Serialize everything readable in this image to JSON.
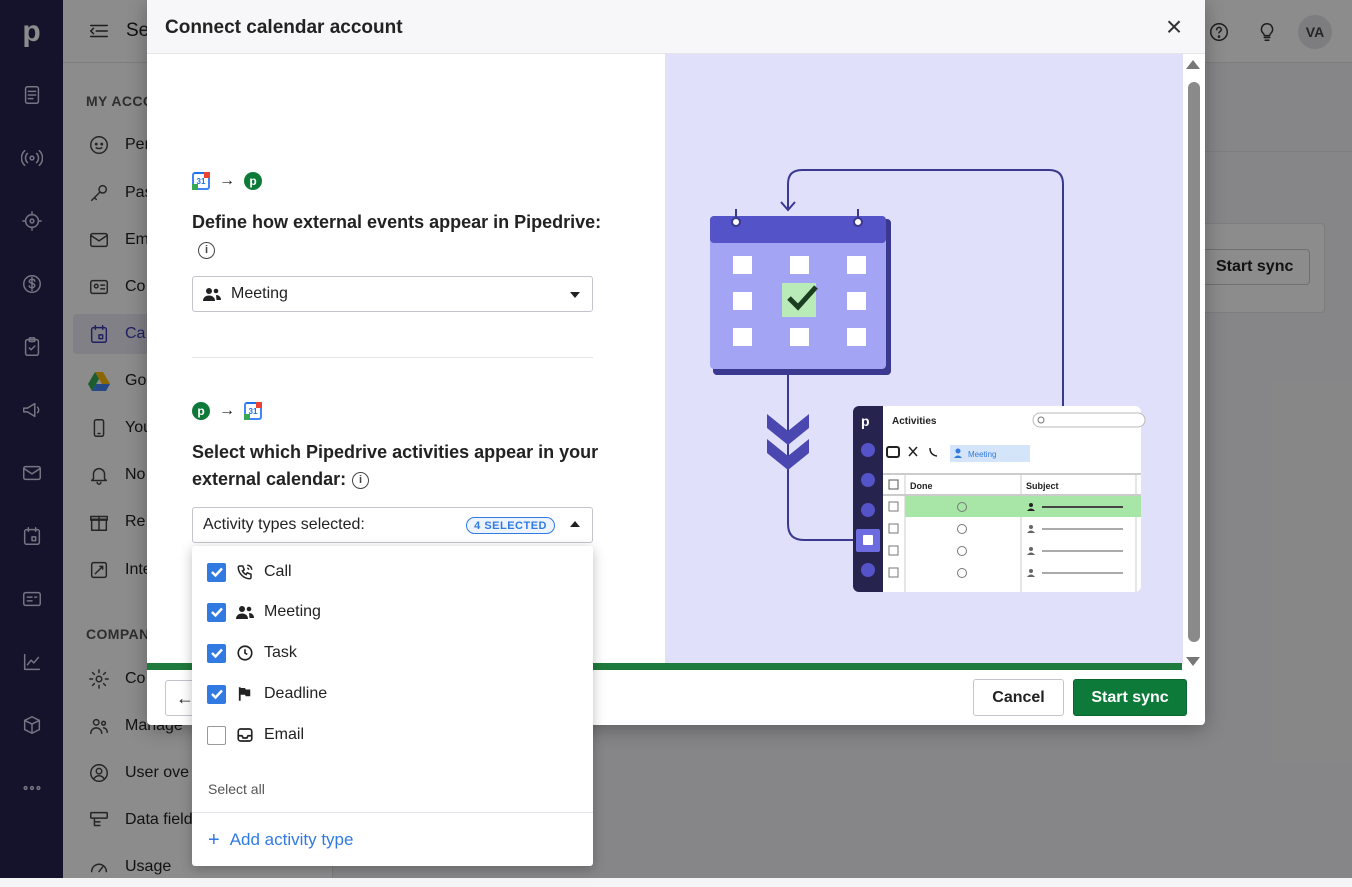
{
  "topbar": {
    "title": "Se",
    "avatar_initials": "VA"
  },
  "settings_sidebar": {
    "heading_account": "MY ACCO",
    "heading_company": "COMPAN",
    "items": [
      {
        "label": "Per",
        "icon": "face-icon"
      },
      {
        "label": "Pas",
        "icon": "key-icon"
      },
      {
        "label": "Em",
        "icon": "mail-icon"
      },
      {
        "label": "Co",
        "icon": "contact-card-icon"
      },
      {
        "label": "Ca",
        "icon": "calendar-icon",
        "active": true
      },
      {
        "label": "Go",
        "icon": "drive-icon"
      },
      {
        "label": "You",
        "icon": "phone-icon"
      },
      {
        "label": "No",
        "icon": "bell-icon"
      },
      {
        "label": "Re",
        "icon": "gift-icon"
      },
      {
        "label": "Inte",
        "icon": "integration-icon"
      },
      {
        "label": "Co",
        "icon": "gear-icon"
      },
      {
        "label": "Manage",
        "icon": "users-icon"
      },
      {
        "label": "User ove",
        "icon": "user-circle-icon"
      },
      {
        "label": "Data field",
        "icon": "data-fields-icon"
      },
      {
        "label": "Usage",
        "icon": "gauge-icon"
      }
    ]
  },
  "background": {
    "start_sync_label": "Start sync"
  },
  "modal": {
    "title": "Connect calendar account",
    "close_glyph": "×",
    "section1": {
      "title": "Define how external events appear in Pipedrive:",
      "select_value": "Meeting"
    },
    "section2": {
      "title": "Select which Pipedrive activities appear in your external calendar:",
      "select_label": "Activity types selected:",
      "badge": "4 SELECTED"
    },
    "cancel_label": "Cancel",
    "start_label": "Start sync",
    "back_glyph": "←",
    "progress": 1.0
  },
  "dropdown": {
    "options": [
      {
        "label": "Call",
        "checked": true,
        "icon": "phone-icon"
      },
      {
        "label": "Meeting",
        "checked": true,
        "icon": "users-icon"
      },
      {
        "label": "Task",
        "checked": true,
        "icon": "clock-icon"
      },
      {
        "label": "Deadline",
        "checked": true,
        "icon": "flag-icon"
      },
      {
        "label": "Email",
        "checked": false,
        "icon": "inbox-icon"
      }
    ],
    "select_all_label": "Select all",
    "add_label": "Add activity type"
  },
  "illustration": {
    "app_title": "Activities",
    "filter_chip": "Meeting",
    "col_done": "Done",
    "col_subject": "Subject"
  },
  "colors": {
    "rail": "#26234f",
    "brand_green": "#0e7a3a",
    "link_blue": "#317ae2",
    "illustration_bg": "#e0e0fb"
  }
}
